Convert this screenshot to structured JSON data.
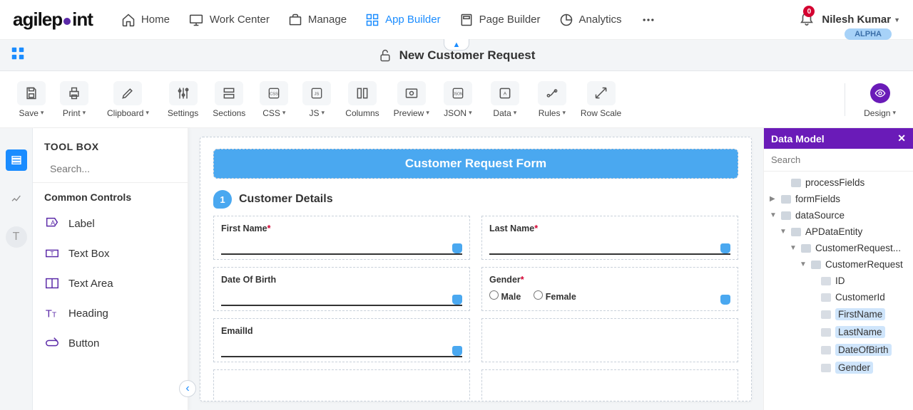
{
  "header": {
    "logo_text_a": "agilep",
    "logo_text_b": "int",
    "nav": {
      "home": "Home",
      "work_center": "Work Center",
      "manage": "Manage",
      "app_builder": "App Builder",
      "page_builder": "Page Builder",
      "analytics": "Analytics"
    },
    "notif_count": "0",
    "username": "Nilesh Kumar",
    "alpha": "ALPHA"
  },
  "titlebar": {
    "title": "New Customer Request"
  },
  "ribbon": {
    "save": "Save",
    "print": "Print",
    "clipboard": "Clipboard",
    "settings": "Settings",
    "sections": "Sections",
    "css": "CSS",
    "js": "JS",
    "columns": "Columns",
    "preview": "Preview",
    "json": "JSON",
    "data": "Data",
    "rules": "Rules",
    "row_scale": "Row Scale",
    "design": "Design"
  },
  "toolbox": {
    "title": "TOOL BOX",
    "search_placeholder": "Search...",
    "section": "Common Controls",
    "items": {
      "label": "Label",
      "textbox": "Text Box",
      "textarea": "Text Area",
      "heading": "Heading",
      "button": "Button"
    }
  },
  "form": {
    "banner": "Customer Request Form",
    "section_num": "1",
    "section_title": "Customer Details",
    "fields": {
      "first_name": "First Name",
      "last_name": "Last Name",
      "dob": "Date Of Birth",
      "gender": "Gender",
      "gender_male": "Male",
      "gender_female": "Female",
      "email": "EmailId"
    }
  },
  "datamodel": {
    "title": "Data Model",
    "search_placeholder": "Search",
    "nodes": {
      "processFields": "processFields",
      "formFields": "formFields",
      "dataSource": "dataSource",
      "apDataEntity": "APDataEntity",
      "customerRequestRoot": "CustomerRequest...",
      "customerRequest": "CustomerRequest",
      "id": "ID",
      "customerId": "CustomerId",
      "firstName": "FirstName",
      "lastName": "LastName",
      "dob": "DateOfBirth",
      "gender": "Gender"
    }
  }
}
